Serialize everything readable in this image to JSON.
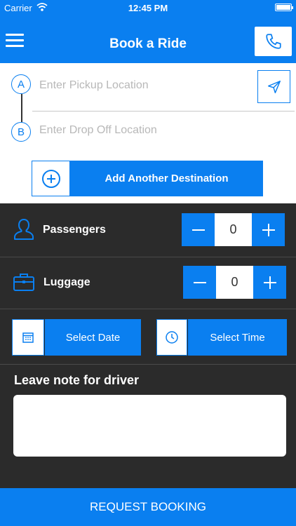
{
  "status_bar": {
    "carrier": "Carrier",
    "time": "12:45 PM"
  },
  "nav": {
    "title": "Book a Ride"
  },
  "locations": {
    "pickup_placeholder": "Enter Pickup Location",
    "dropoff_placeholder": "Enter Drop Off Location",
    "marker_a": "A",
    "marker_b": "B",
    "add_destination_label": "Add Another Destination"
  },
  "passengers": {
    "label": "Passengers",
    "value": "0"
  },
  "luggage": {
    "label": "Luggage",
    "value": "0"
  },
  "schedule": {
    "date_label": "Select Date",
    "time_label": "Select Time"
  },
  "note": {
    "label": "Leave note for driver",
    "value": ""
  },
  "footer": {
    "request_label": "REQUEST BOOKING"
  },
  "colors": {
    "accent": "#0a7ff0",
    "background": "#2b2b2b",
    "panel": "#ffffff"
  },
  "icons": [
    "wifi-icon",
    "battery-icon",
    "menu-icon",
    "phone-icon",
    "locate-arrow-icon",
    "plus-circle-icon",
    "person-icon",
    "minus-icon",
    "plus-icon",
    "briefcase-icon",
    "calendar-icon",
    "clock-icon"
  ]
}
